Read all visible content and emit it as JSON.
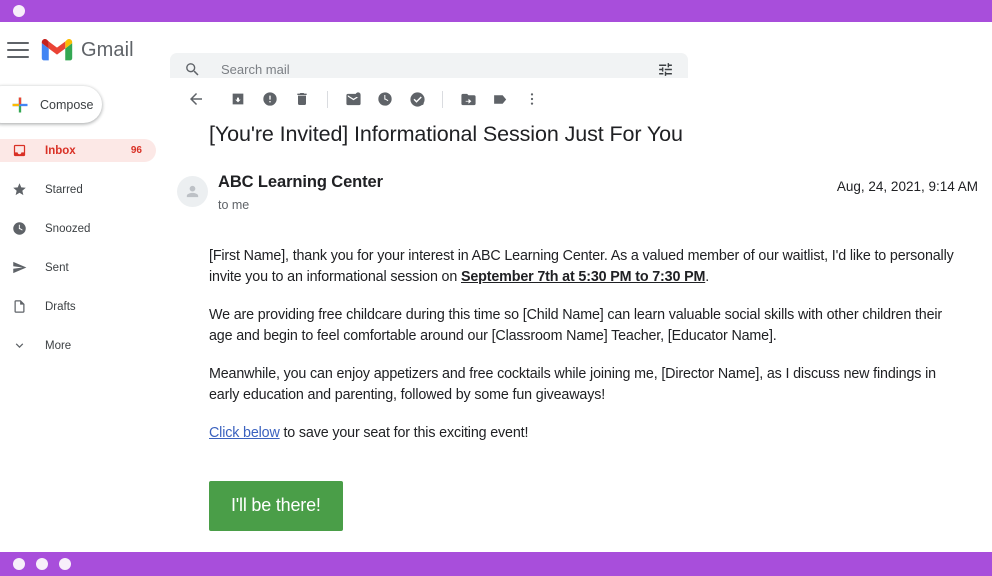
{
  "window": {
    "chrome_color": "#a84edb",
    "top_dots": 1,
    "bottom_dots": 3
  },
  "header": {
    "menu_icon": "hamburger-icon",
    "brand": "Gmail",
    "logo_icon": "gmail-m-logo"
  },
  "search": {
    "placeholder": "Search mail",
    "value": "",
    "icon": "search-icon",
    "filter_icon": "tune-filter-icon"
  },
  "sidebar": {
    "compose": {
      "label": "Compose",
      "icon": "plus-icon"
    },
    "items": [
      {
        "label": "Inbox",
        "icon": "inbox-icon",
        "count": "96",
        "active": true
      },
      {
        "label": "Starred",
        "icon": "star-icon",
        "count": "",
        "active": false
      },
      {
        "label": "Snoozed",
        "icon": "clock-icon",
        "count": "",
        "active": false
      },
      {
        "label": "Sent",
        "icon": "send-icon",
        "count": "",
        "active": false
      },
      {
        "label": "Drafts",
        "icon": "draft-file-icon",
        "count": "",
        "active": false
      },
      {
        "label": "More",
        "icon": "chevron-down-icon",
        "count": "",
        "active": false
      }
    ]
  },
  "toolbar": {
    "buttons": [
      {
        "name": "back-arrow-icon",
        "title": "Back to Inbox"
      },
      {
        "name": "archive-icon",
        "title": "Archive"
      },
      {
        "name": "report-spam-icon",
        "title": "Report spam"
      },
      {
        "name": "delete-trash-icon",
        "title": "Delete"
      },
      {
        "name": "mark-unread-icon",
        "title": "Mark as unread"
      },
      {
        "name": "snooze-clock-icon",
        "title": "Snooze"
      },
      {
        "name": "add-to-tasks-icon",
        "title": "Add to Tasks"
      },
      {
        "name": "move-to-folder-icon",
        "title": "Move to"
      },
      {
        "name": "labels-tag-icon",
        "title": "Labels"
      },
      {
        "name": "more-options-icon",
        "title": "More"
      }
    ]
  },
  "email": {
    "subject": "[You're Invited] Informational Session Just For You",
    "sender": "ABC Learning Center",
    "recipient": "to me",
    "date": "Aug, 24, 2021, 9:14 AM",
    "avatar_icon": "person-avatar-icon",
    "paragraphs": [
      {
        "segments": [
          {
            "text": "[First Name], thank you for your interest in ABC Learning Center. As a valued member of our waitlist, I'd like to personally invite you to an informational session on ",
            "style": "normal"
          },
          {
            "text": "September 7th at 5:30 PM to 7:30 PM",
            "style": "bold-underline"
          },
          {
            "text": ".",
            "style": "normal"
          }
        ]
      },
      {
        "segments": [
          {
            "text": "We are providing free childcare during this time so [Child Name] can learn valuable social skills with other children their age and begin to feel comfortable around our [Classroom Name] Teacher, [Educator Name].",
            "style": "normal"
          }
        ]
      },
      {
        "segments": [
          {
            "text": "Meanwhile, you can enjoy appetizers and free cocktails while joining me, [Director Name], as I discuss new findings in early education and parenting, followed by some fun giveaways!",
            "style": "normal"
          }
        ]
      },
      {
        "segments": [
          {
            "text": "Click below",
            "style": "link"
          },
          {
            "text": " to save your seat for this exciting event!",
            "style": "normal"
          }
        ]
      }
    ],
    "cta": {
      "label": "I'll be there!",
      "color": "#4a9e48"
    }
  }
}
